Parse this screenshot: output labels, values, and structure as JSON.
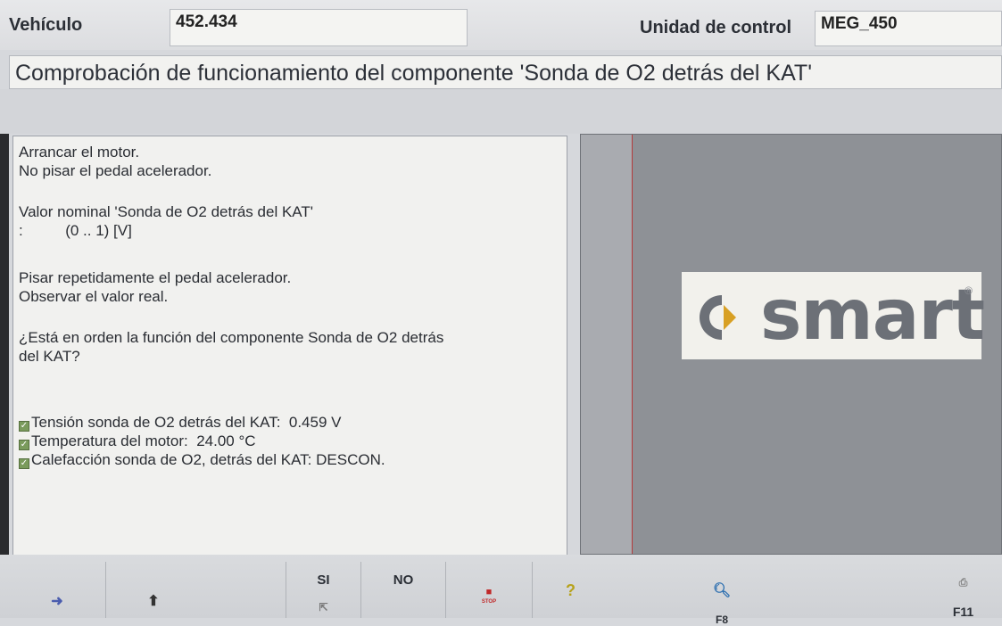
{
  "header": {
    "vehicle_label": "Vehículo",
    "vehicle_value": "452.434",
    "control_unit_label": "Unidad de control",
    "control_unit_value": "MEG_450"
  },
  "title": "Comprobación de funcionamiento del componente 'Sonda de O2 detrás del KAT'",
  "instructions": {
    "line1": "Arrancar el motor.",
    "line2": "No pisar el pedal acelerador.",
    "nominal_label": "Valor nominal 'Sonda de O2 detrás del KAT'",
    "nominal_prefix": ":",
    "nominal_value": "(0 .. 1) [V]",
    "line3": "Pisar repetidamente el pedal acelerador.",
    "line4": "Observar el valor real.",
    "question_l1": "¿Está en orden la función del componente Sonda de O2 detrás",
    "question_l2": "del KAT?"
  },
  "readings": [
    {
      "label": "Tensión sonda de O2 detrás del KAT:",
      "value": "0.459 V"
    },
    {
      "label": "Temperatura del motor:",
      "value": "24.00 °C"
    },
    {
      "label": "Calefacción sonda de O2, detrás del KAT:",
      "value": "DESCON."
    }
  ],
  "logo": {
    "text": "smart",
    "reg": "®"
  },
  "toolbar": {
    "yes": "SI",
    "no": "NO",
    "stop_caption": "STOP",
    "f8": "F8",
    "f11": "F11"
  },
  "colors": {
    "logo_red": "#b43b3b",
    "check_green": "#7a9b5c"
  }
}
